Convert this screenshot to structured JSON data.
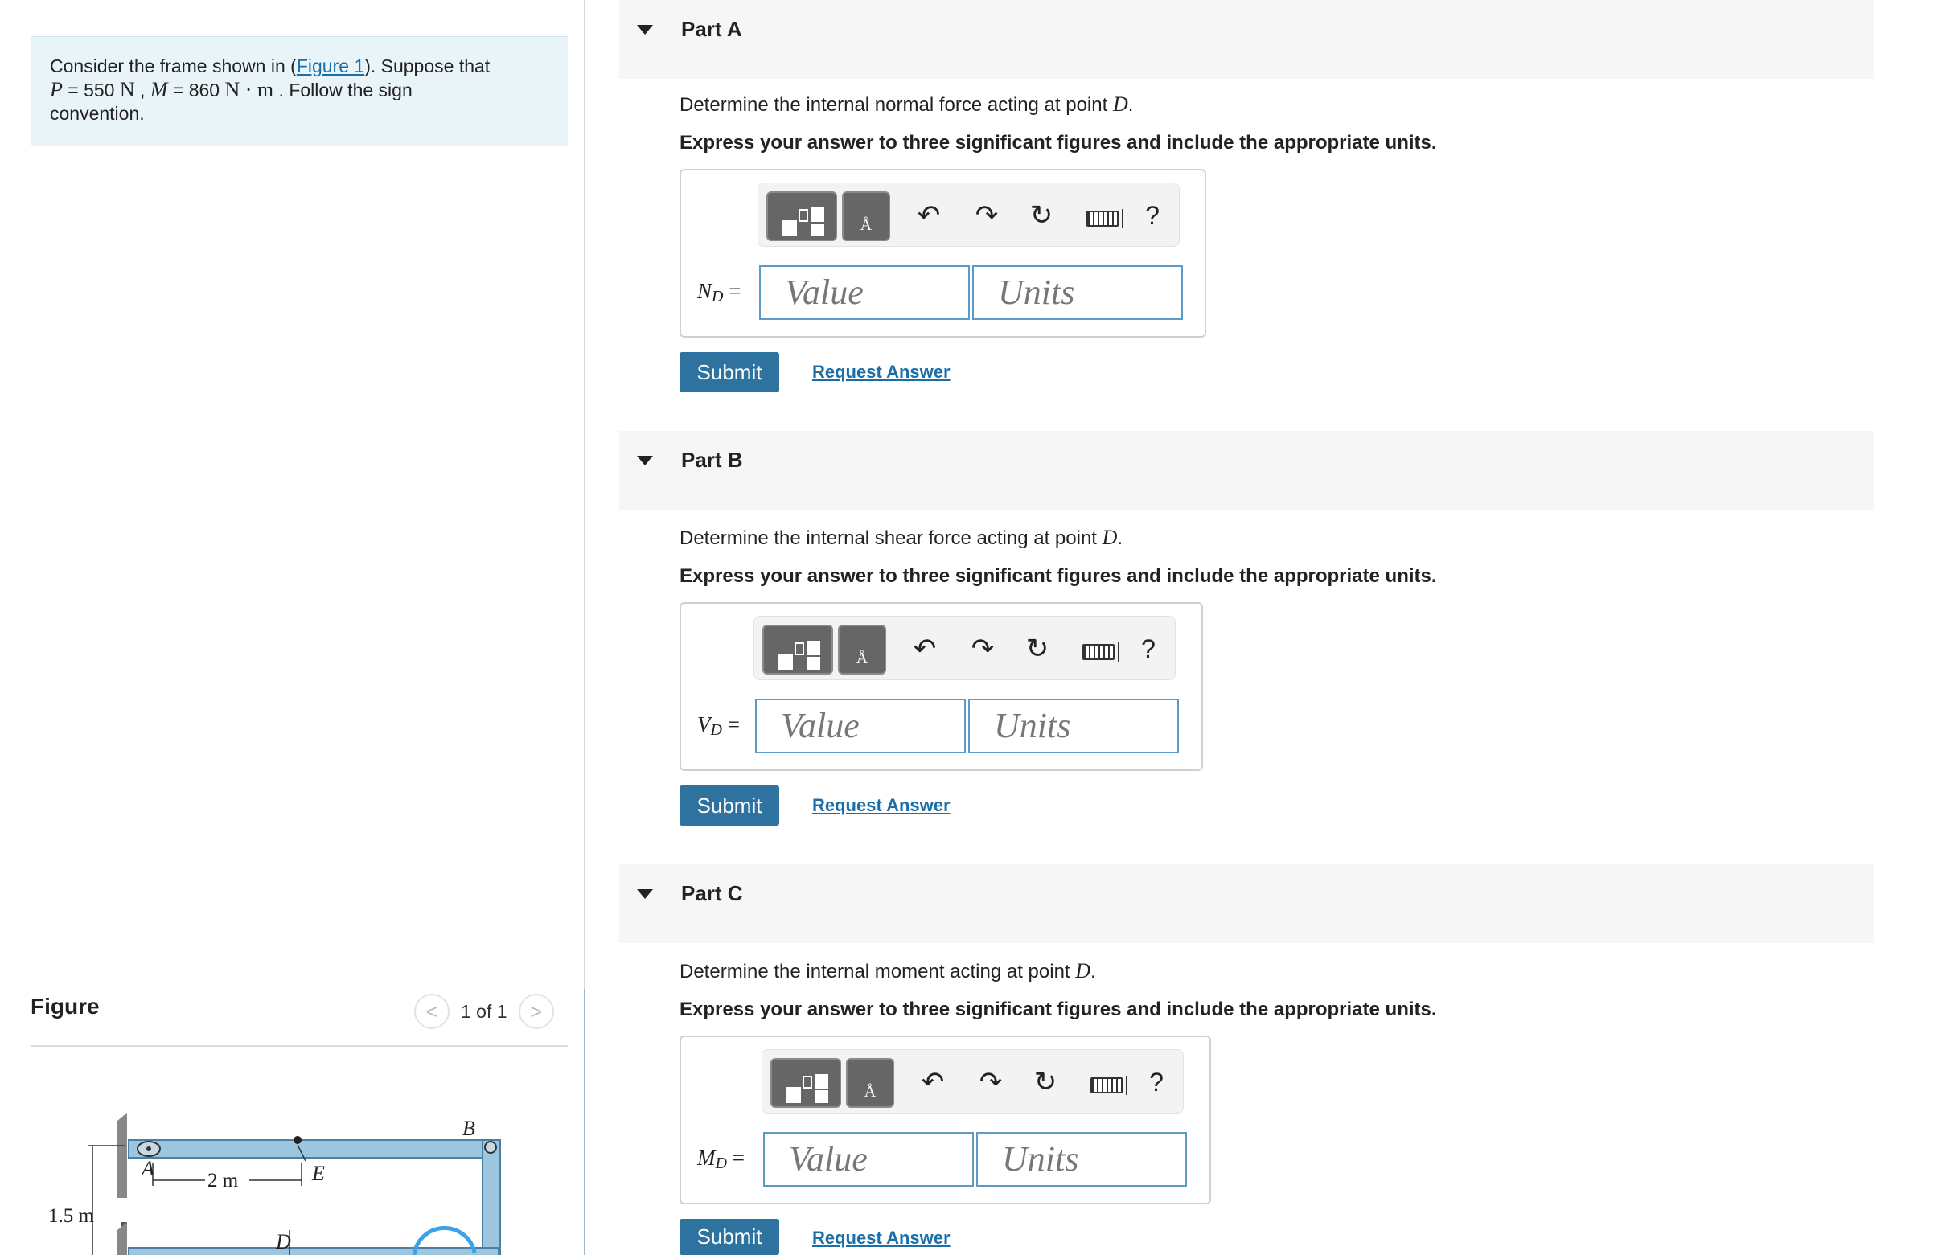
{
  "problem": {
    "intro": "Consider the frame shown in (",
    "figure_link": "Figure 1",
    "after_link": "). Suppose that",
    "p_var": "P",
    "p_eq": " = 550 ",
    "p_unit": "N",
    "comma": " , ",
    "m_var": "M",
    "m_eq": " = 860 ",
    "m_unit": "N · m",
    "tail": " . Follow the sign",
    "tail2": "convention."
  },
  "figure": {
    "title": "Figure",
    "counter": "1 of 1",
    "prev": "<",
    "next": ">",
    "labels": {
      "A": "A",
      "B": "B",
      "D": "D",
      "E": "E",
      "dim_2m": "2 m",
      "dim_15m": "1.5 m"
    }
  },
  "parts": [
    {
      "title": "Part A",
      "question_pre": "Determine the internal normal force acting at point ",
      "question_var": "D",
      "question_post": ".",
      "instruction": "Express your answer to three significant figures and include the appropriate units.",
      "var": "N",
      "var_sub": "D",
      "eq": " =",
      "value_placeholder": "Value",
      "units_placeholder": "Units",
      "submit": "Submit",
      "request": "Request Answer"
    },
    {
      "title": "Part B",
      "question_pre": "Determine the internal shear force acting at point ",
      "question_var": "D",
      "question_post": ".",
      "instruction": "Express your answer to three significant figures and include the appropriate units.",
      "var": "V",
      "var_sub": "D",
      "eq": " =",
      "value_placeholder": "Value",
      "units_placeholder": "Units",
      "submit": "Submit",
      "request": "Request Answer"
    },
    {
      "title": "Part C",
      "question_pre": "Determine the internal moment acting at point ",
      "question_var": "D",
      "question_post": ".",
      "instruction": "Express your answer to three significant figures and include the appropriate units.",
      "var": "M",
      "var_sub": "D",
      "eq": " =",
      "value_placeholder": "Value",
      "units_placeholder": "Units",
      "submit": "Submit",
      "request": "Request Answer"
    }
  ],
  "toolbar": {
    "templates_icon": "templates-icon",
    "units_icon": "units-icon",
    "unit_glyph": "Å",
    "undo": "↶",
    "redo": "↷",
    "reset": "↻",
    "help": "?"
  },
  "colors": {
    "accent": "#2e73a0",
    "link": "#1b6fa8",
    "problem_bg": "#e9f4f8",
    "part_bg": "#f6f6f6",
    "field_border": "#5b9bc6",
    "frame_blue": "#9cc6e0"
  }
}
